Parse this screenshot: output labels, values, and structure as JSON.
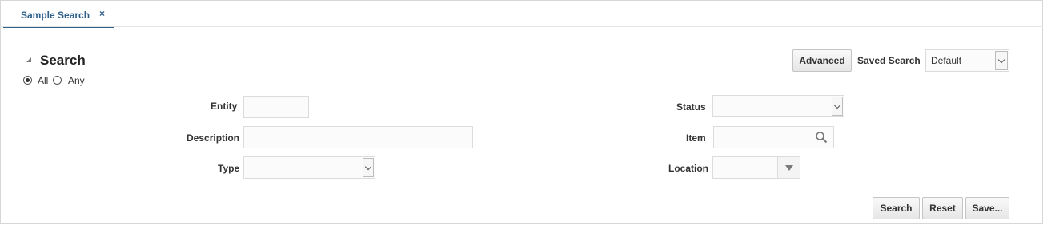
{
  "tab": {
    "label": "Sample Search",
    "close_symbol": "×"
  },
  "search": {
    "title": "Search",
    "match_options": [
      {
        "label": "All",
        "checked": true
      },
      {
        "label": "Any",
        "checked": false
      }
    ],
    "advanced_label_prefix": "A",
    "advanced_label_mnemonic": "d",
    "advanced_label_suffix": "vanced",
    "saved_search_label": "Saved Search",
    "saved_search_value": "Default"
  },
  "fields": {
    "entity_label": "Entity",
    "entity_value": "",
    "description_label": "Description",
    "description_value": "",
    "type_label": "Type",
    "type_value": "",
    "status_label": "Status",
    "status_value": "",
    "item_label": "Item",
    "item_value": "",
    "location_label": "Location",
    "location_value": ""
  },
  "actions": {
    "search_label": "Search",
    "reset_label": "Reset",
    "save_label": "Save..."
  },
  "icons": {
    "collapse": "triangle-collapse-icon",
    "search": "magnifier-icon",
    "dropdown": "chevron-down-icon",
    "location_dropdown": "triangle-down-icon"
  },
  "colors": {
    "accent": "#2d5f8b",
    "button_bg": "#ececec",
    "border": "#dcdcdc"
  }
}
